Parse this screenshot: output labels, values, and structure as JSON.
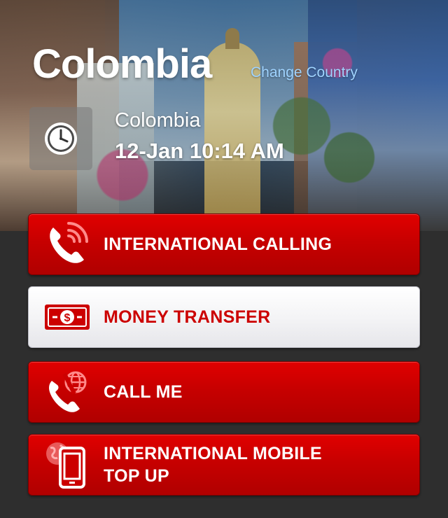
{
  "header": {
    "country_title": "Colombia",
    "change_country_label": "Change Country"
  },
  "local_time": {
    "country": "Colombia",
    "datetime": "12-Jan 10:14 AM",
    "icon": "clock-icon"
  },
  "menu": {
    "items": [
      {
        "id": "international-calling",
        "label": "INTERNATIONAL CALLING",
        "icon": "phone-signal-icon",
        "style": "red"
      },
      {
        "id": "money-transfer",
        "label": "MONEY TRANSFER",
        "icon": "dollar-bill-icon",
        "style": "white"
      },
      {
        "id": "call-me",
        "label": "CALL ME",
        "icon": "phone-globe-icon",
        "style": "red"
      },
      {
        "id": "international-mobile-top-up",
        "label_line1": "INTERNATIONAL MOBILE",
        "label_line2": "TOP UP",
        "icon": "mobile-globe-icon",
        "style": "red"
      }
    ]
  },
  "colors": {
    "primary_red": "#cc0000",
    "link_blue": "#9fd3ff",
    "background": "#2e2e2e"
  }
}
